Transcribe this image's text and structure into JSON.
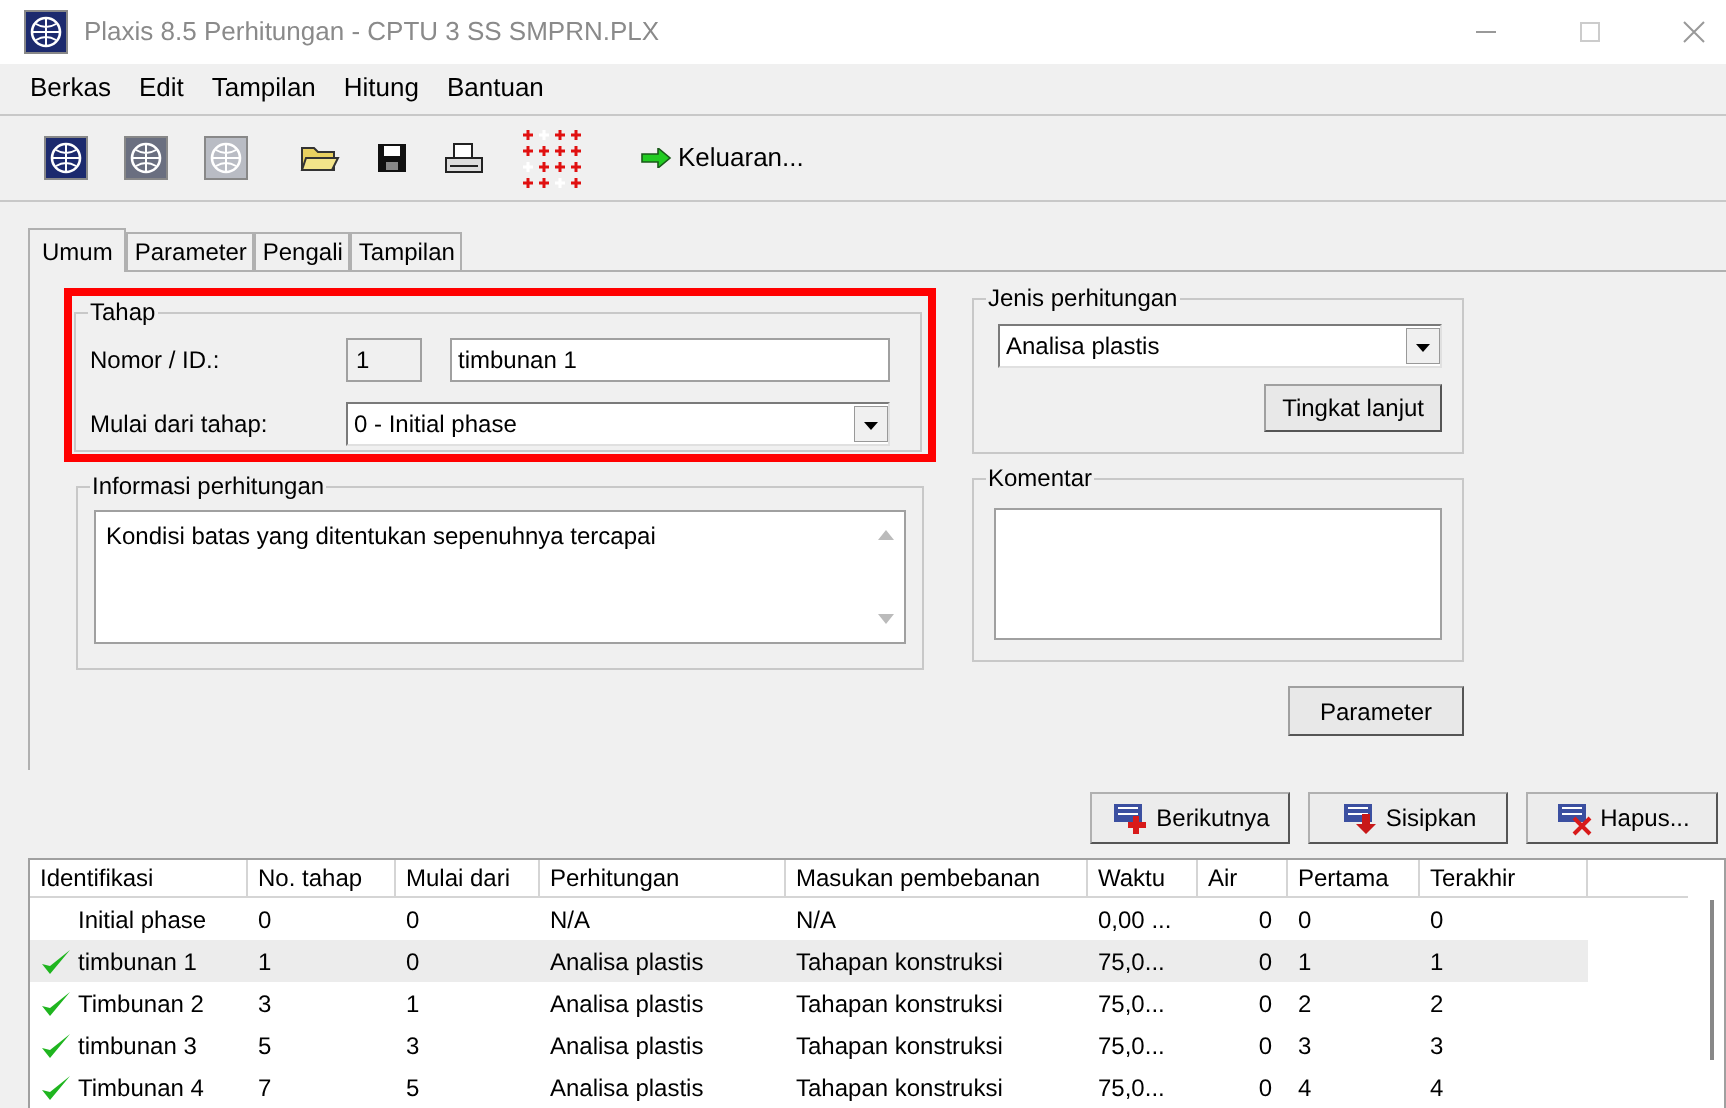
{
  "window": {
    "title": "Plaxis 8.5 Perhitungan - CPTU 3 SS SMPRN.PLX"
  },
  "menu": [
    "Berkas",
    "Edit",
    "Tampilan",
    "Hitung",
    "Bantuan"
  ],
  "toolbar": {
    "output_label": "Keluaran..."
  },
  "tabs": [
    {
      "label": "Umum",
      "selected": true
    },
    {
      "label": "Parameter",
      "selected": false
    },
    {
      "label": "Pengali",
      "selected": false
    },
    {
      "label": "Tampilan",
      "selected": false
    }
  ],
  "tahap": {
    "title": "Tahap",
    "highlighted": true,
    "id_label": "Nomor / ID.:",
    "number": "1",
    "id_value": "timbunan 1",
    "start_label": "Mulai dari tahap:",
    "start_value": "0 - Initial phase"
  },
  "jenis": {
    "title": "Jenis perhitungan",
    "value": "Analisa plastis",
    "button": "Tingkat lanjut"
  },
  "informasi": {
    "title": "Informasi perhitungan",
    "text": "Kondisi batas yang ditentukan sepenuhnya tercapai"
  },
  "komentar": {
    "title": "Komentar"
  },
  "parameter_button": "Parameter",
  "phase_buttons": [
    {
      "label": "Berikutnya",
      "kind": "add"
    },
    {
      "label": "Sisipkan",
      "kind": "insert"
    },
    {
      "label": "Hapus...",
      "kind": "delete"
    }
  ],
  "table": {
    "columns": [
      "Identifikasi",
      "No. tahap",
      "Mulai dari",
      "Perhitungan",
      "Masukan pembebanan",
      "Waktu",
      "Air",
      "Pertama",
      "Terakhir"
    ],
    "rows": [
      {
        "calculated": false,
        "selected": false,
        "cells": [
          "Initial phase",
          "0",
          "0",
          "N/A",
          "N/A",
          "0,00 ...",
          "0",
          "0",
          "0"
        ]
      },
      {
        "calculated": true,
        "selected": true,
        "cells": [
          "timbunan 1",
          "1",
          "0",
          "Analisa plastis",
          "Tahapan konstruksi",
          "75,0...",
          "0",
          "1",
          "1"
        ]
      },
      {
        "calculated": true,
        "selected": false,
        "cells": [
          "Timbunan 2",
          "3",
          "1",
          "Analisa plastis",
          "Tahapan konstruksi",
          "75,0...",
          "0",
          "2",
          "2"
        ]
      },
      {
        "calculated": true,
        "selected": false,
        "cells": [
          "timbunan 3",
          "5",
          "3",
          "Analisa plastis",
          "Tahapan konstruksi",
          "75,0...",
          "0",
          "3",
          "3"
        ]
      },
      {
        "calculated": true,
        "selected": false,
        "cells": [
          "Timbunan 4",
          "7",
          "5",
          "Analisa plastis",
          "Tahapan konstruksi",
          "75,0...",
          "0",
          "4",
          "4"
        ]
      }
    ]
  }
}
